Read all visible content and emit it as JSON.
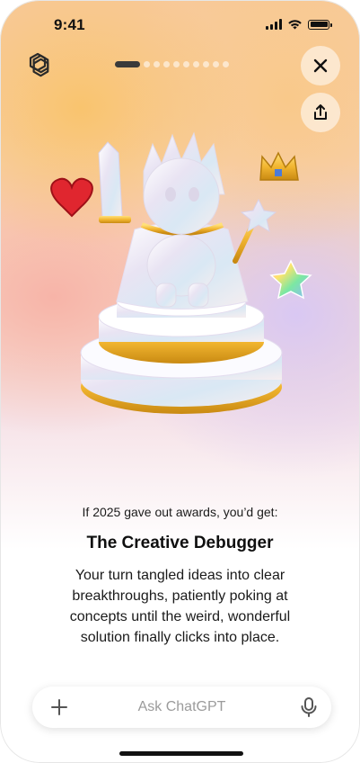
{
  "status_bar": {
    "time": "9:41"
  },
  "header": {
    "logo_icon": "openai-logo-icon",
    "progress": {
      "current": 1,
      "total": 10
    },
    "close_icon": "close-icon",
    "share_icon": "share-icon"
  },
  "award": {
    "intro": "If 2025 gave out awards, you’d get:",
    "title": "The Creative Debugger",
    "description": "Your turn tangled ideas into clear breakthroughs, patiently poking at concepts until the weird, wonderful solution finally clicks into place."
  },
  "composer": {
    "placeholder": "Ask ChatGPT",
    "plus_icon": "plus-icon",
    "mic_icon": "microphone-icon"
  },
  "colors": {
    "accent_gold": "#f2b631",
    "text_dark": "#111111"
  }
}
